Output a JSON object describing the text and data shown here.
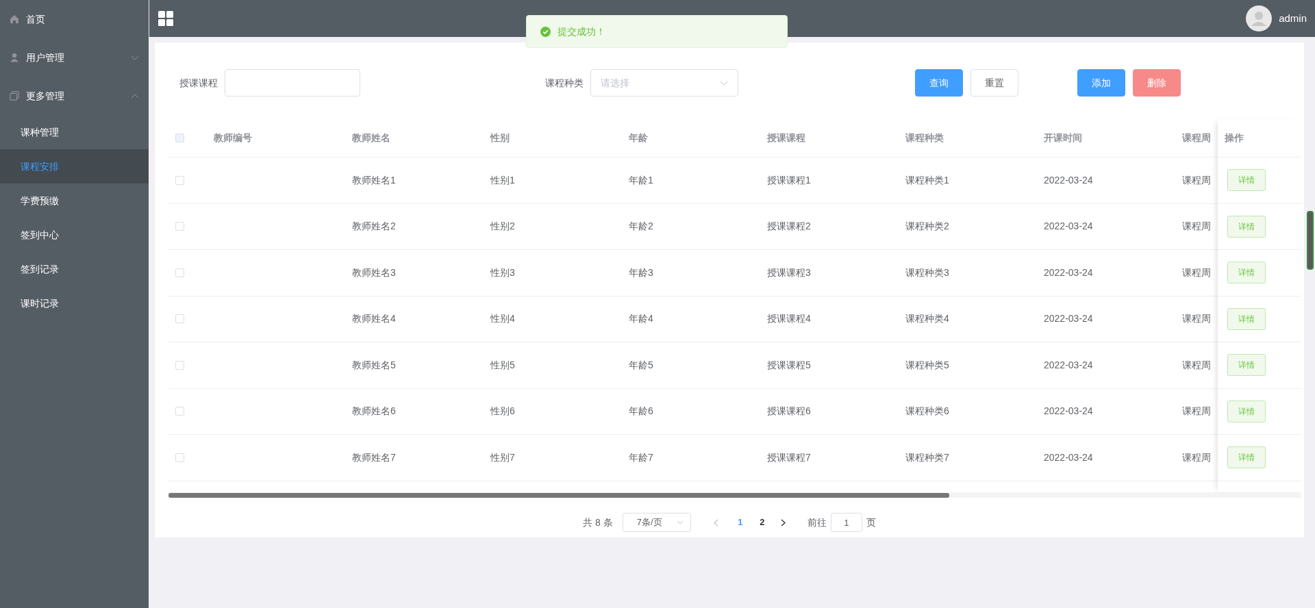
{
  "sidebar": {
    "items": [
      {
        "label": "首页",
        "kind": "link"
      },
      {
        "label": "用户管理",
        "kind": "submenu",
        "expanded": false
      },
      {
        "label": "更多管理",
        "kind": "submenu",
        "expanded": true,
        "children": [
          {
            "label": "课种管理",
            "selected": false
          },
          {
            "label": "课程安排",
            "selected": true
          },
          {
            "label": "学费预缴",
            "selected": false
          },
          {
            "label": "签到中心",
            "selected": false
          },
          {
            "label": "签到记录",
            "selected": false
          },
          {
            "label": "课时记录",
            "selected": false
          }
        ]
      }
    ]
  },
  "header": {
    "user": "admin"
  },
  "toast": {
    "message": "提交成功！"
  },
  "filters": [
    {
      "label": "授课课程",
      "kind": "input"
    },
    {
      "label": "课程种类",
      "kind": "select",
      "placeholder": "请选择"
    }
  ],
  "buttons": [
    {
      "label": "查询",
      "kind": "primary"
    },
    {
      "label": "重置",
      "kind": "default"
    },
    {
      "label": "添加",
      "kind": "primary"
    },
    {
      "label": "删除",
      "kind": "danger"
    }
  ],
  "table": {
    "select_all_checked": false,
    "columns": [
      "教师编号",
      "教师姓名",
      "性别",
      "年龄",
      "授课课程",
      "课程种类",
      "开课时间",
      "课程周"
    ],
    "action_column": "操作",
    "rows": [
      {
        "checked": false,
        "cells": [
          "",
          "教师姓名1",
          "性别1",
          "年龄1",
          "授课课程1",
          "课程种类1",
          "2022-03-24",
          "课程周"
        ],
        "action": "详情"
      },
      {
        "checked": false,
        "cells": [
          "",
          "教师姓名2",
          "性别2",
          "年龄2",
          "授课课程2",
          "课程种类2",
          "2022-03-24",
          "课程周"
        ],
        "action": "详情"
      },
      {
        "checked": false,
        "cells": [
          "",
          "教师姓名3",
          "性别3",
          "年龄3",
          "授课课程3",
          "课程种类3",
          "2022-03-24",
          "课程周"
        ],
        "action": "详情"
      },
      {
        "checked": false,
        "cells": [
          "",
          "教师姓名4",
          "性别4",
          "年龄4",
          "授课课程4",
          "课程种类4",
          "2022-03-24",
          "课程周"
        ],
        "action": "详情"
      },
      {
        "checked": false,
        "cells": [
          "",
          "教师姓名5",
          "性别5",
          "年龄5",
          "授课课程5",
          "课程种类5",
          "2022-03-24",
          "课程周"
        ],
        "action": "详情"
      },
      {
        "checked": false,
        "cells": [
          "",
          "教师姓名6",
          "性别6",
          "年龄6",
          "授课课程6",
          "课程种类6",
          "2022-03-24",
          "课程周"
        ],
        "action": "详情"
      },
      {
        "checked": false,
        "cells": [
          "",
          "教师姓名7",
          "性别7",
          "年龄7",
          "授课课程7",
          "课程种类7",
          "2022-03-24",
          "课程周"
        ],
        "action": "详情"
      }
    ]
  },
  "pagination": {
    "total": "共 8 条",
    "page_size": "7条/页",
    "prev_disabled": true,
    "pages": [
      {
        "label": "1",
        "selected": true
      },
      {
        "label": "2",
        "selected": false
      }
    ],
    "goto_label": "前往",
    "goto_value": "1",
    "goto_suffix": "页"
  }
}
